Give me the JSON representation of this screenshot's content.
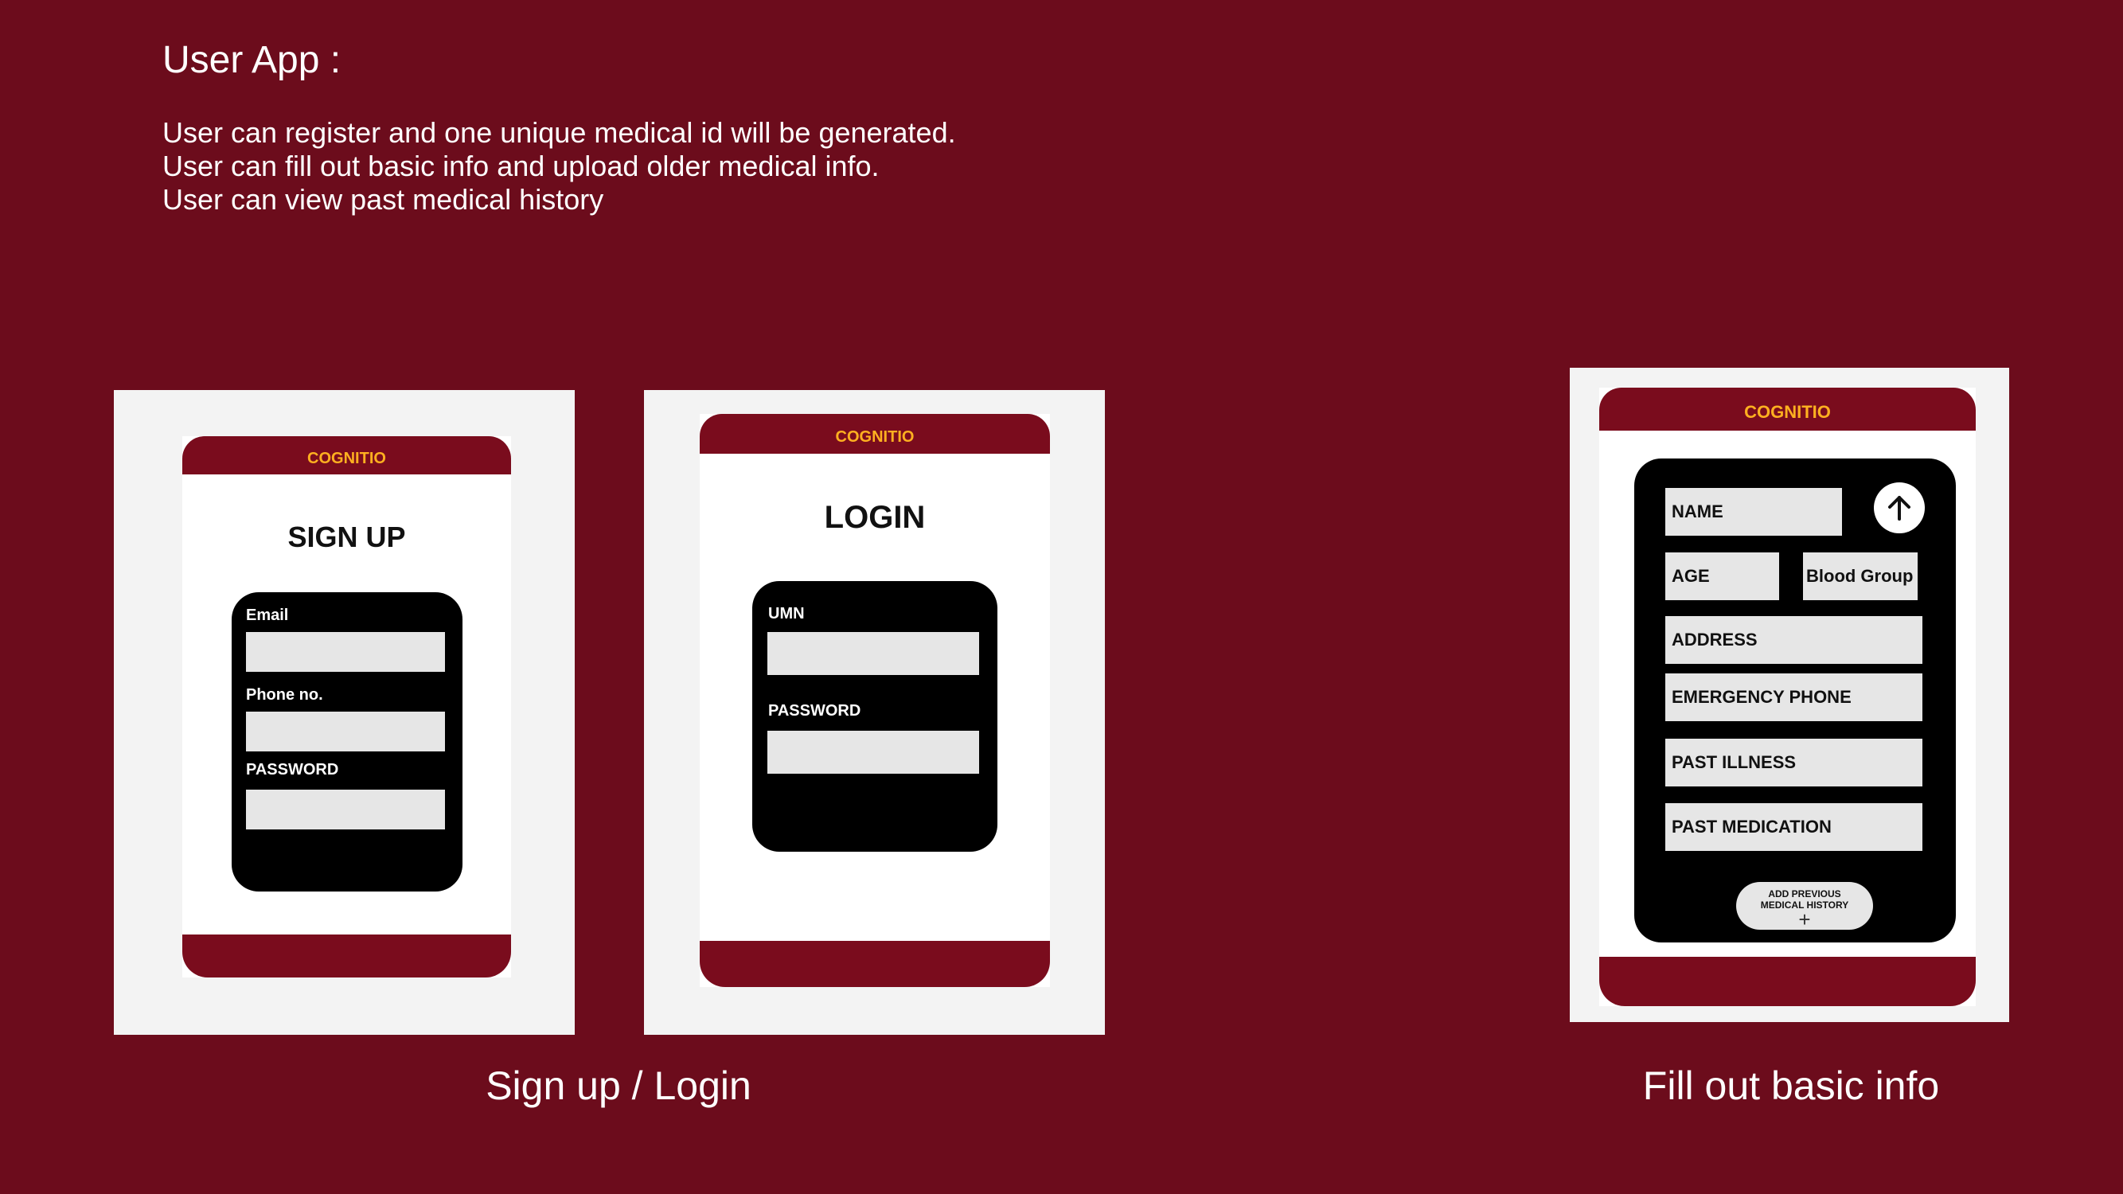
{
  "heading": "User App :",
  "description": [
    "User can register and one unique medical id will be generated.",
    "User can fill out basic info and upload older medical info.",
    "User can view past medical history"
  ],
  "captions": {
    "signup_login": "Sign up / Login",
    "basic_info": "Fill out basic info"
  },
  "brand": "COGNITIO",
  "colors": {
    "background": "#6c0c1c",
    "brand_bar": "#7a0c1d",
    "brand_text": "#ffb020",
    "form_card": "#000000",
    "field": "#e6e6e6"
  },
  "signup": {
    "title": "SIGN UP",
    "fields": [
      "Email",
      "Phone no.",
      "PASSWORD"
    ]
  },
  "login": {
    "title": "LOGIN",
    "fields": [
      "UMN",
      "PASSWORD"
    ]
  },
  "basic_info": {
    "name": "NAME",
    "age": "AGE",
    "blood_group": "Blood Group",
    "address": "ADDRESS",
    "emergency_phone": "EMERGENCY PHONE",
    "past_illness": "PAST ILLNESS",
    "past_medication": "PAST MEDICATION",
    "add_history_line1": "ADD PREVIOUS",
    "add_history_line2": "MEDICAL HISTORY",
    "add_history_icon": "plus-icon",
    "upload_icon": "arrow-up-icon"
  }
}
